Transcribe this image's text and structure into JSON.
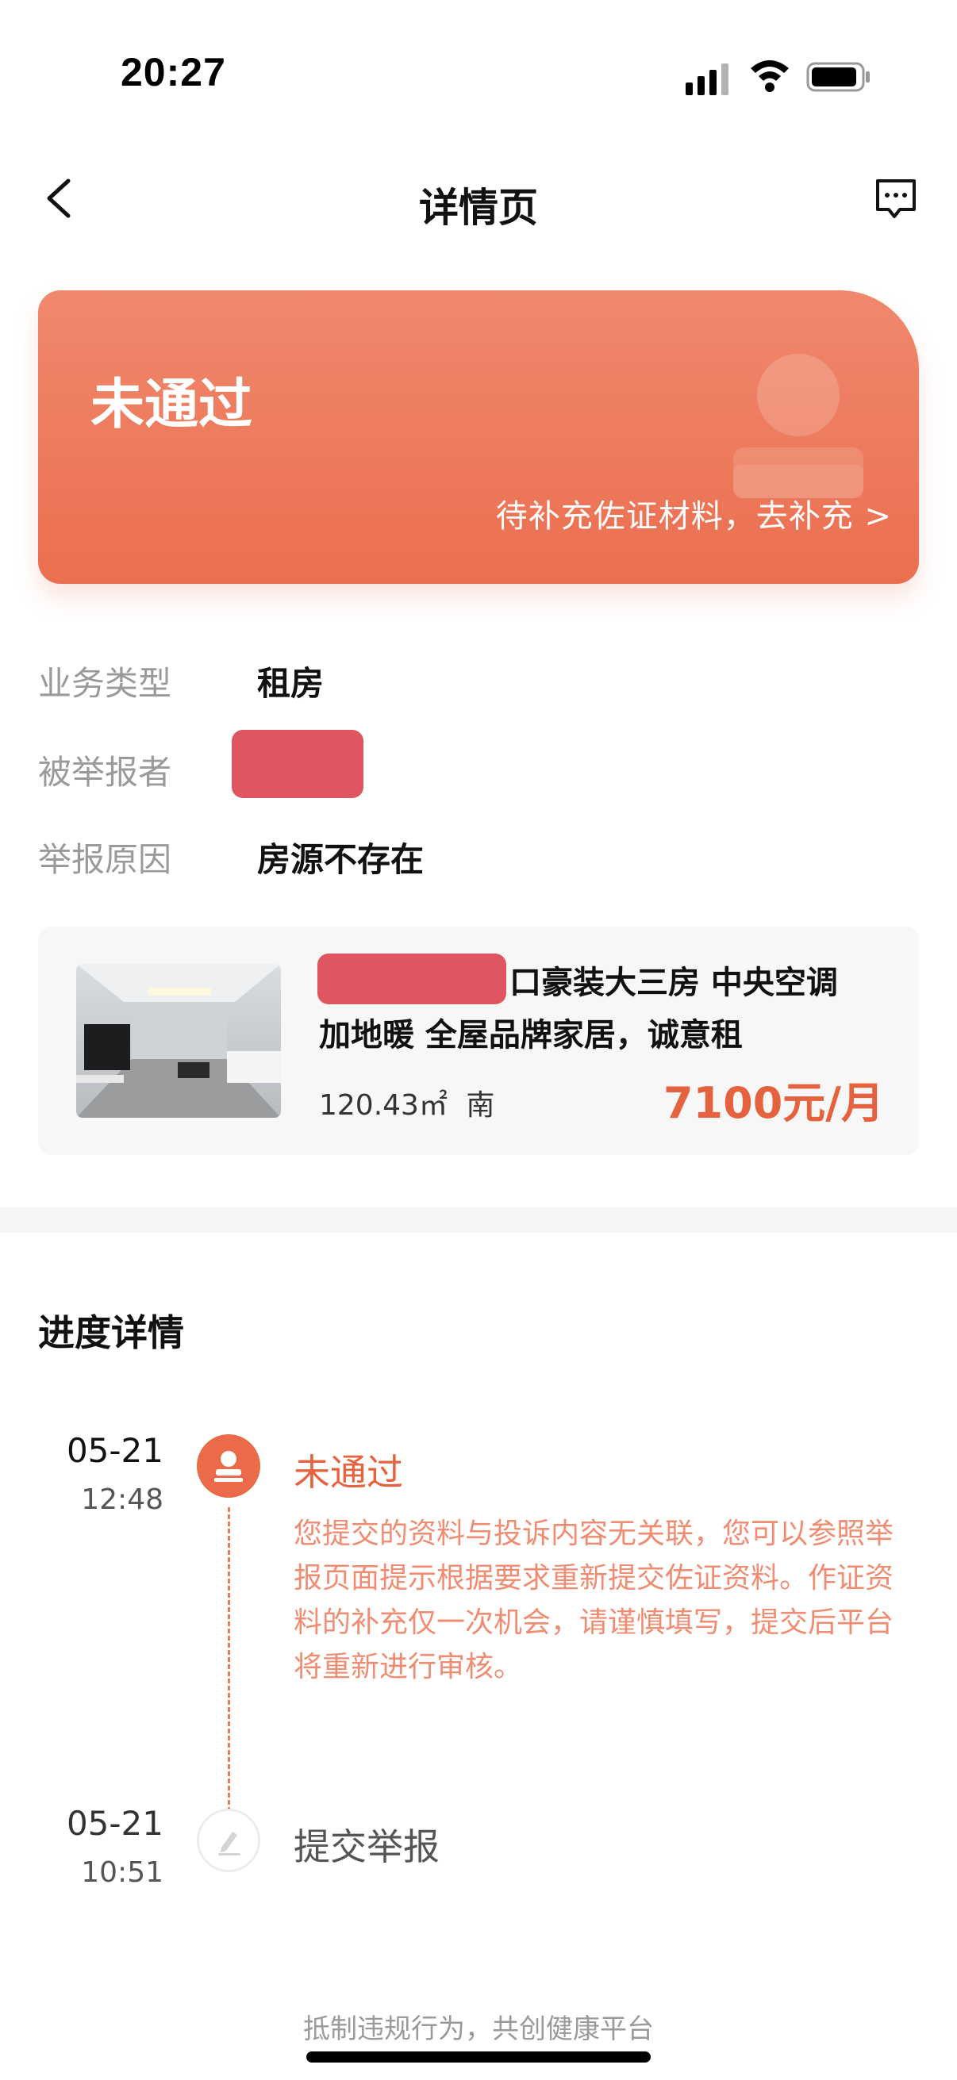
{
  "status_bar": {
    "time": "20:27"
  },
  "nav": {
    "title": "详情页",
    "back_icon": "chevron-left-icon",
    "message_icon": "message-icon"
  },
  "banner": {
    "status": "未通过",
    "link_text": "待补充佐证材料，去补充 >",
    "gradient_top": "#f0886d",
    "gradient_bottom": "#eb6f4f"
  },
  "info": {
    "business_type_label": "业务类型",
    "business_type_value": "租房",
    "reported_label": "被举报者",
    "reason_label": "举报原因",
    "reason_value": "房源不存在"
  },
  "house": {
    "title": "口豪装大三房 中央空调加地暖 全屋品牌家居，诚意租",
    "area": "120.43㎡",
    "orientation": "南",
    "price": "7100元/月"
  },
  "progress": {
    "title": "进度详情",
    "items": [
      {
        "date": "05-21",
        "time": "12:48",
        "status": "未通过",
        "description": "您提交的资料与投诉内容无关联，您可以参照举报页面提示根据要求重新提交佐证资料。作证资料的补充仅一次机会，请谨慎填写，提交后平台将重新进行审核。",
        "icon": "person-icon",
        "color": "#ea6a49"
      },
      {
        "date": "05-21",
        "time": "10:51",
        "status": "提交举报",
        "icon": "pencil-icon"
      }
    ]
  },
  "footer": {
    "slogan": "抵制违规行为，共创健康平台"
  },
  "colors": {
    "accent": "#ea6a49",
    "price": "#e5623f",
    "redaction": "#e05660"
  }
}
